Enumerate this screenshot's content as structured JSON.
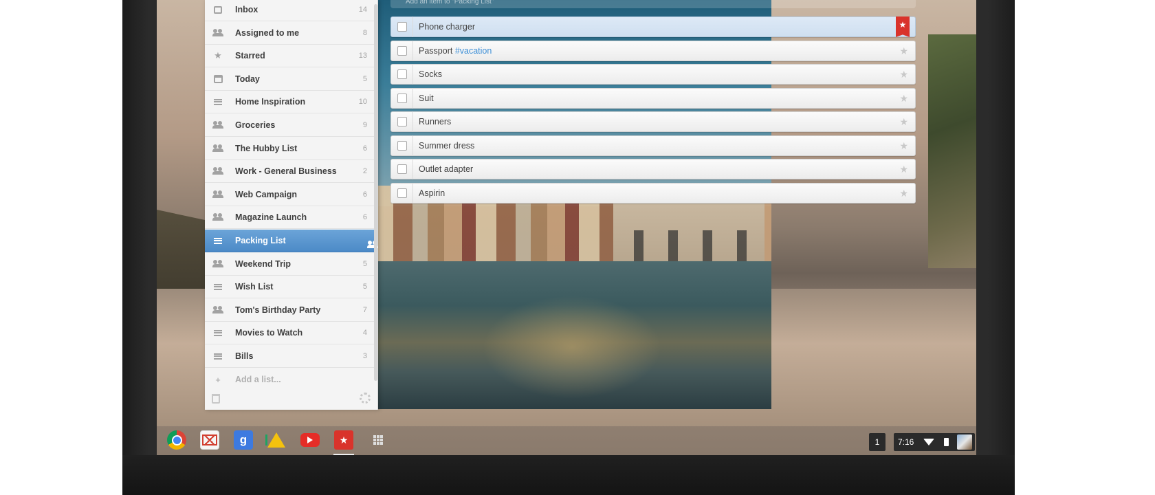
{
  "search": {
    "placeholder": "Add an item to \"Packing List\""
  },
  "sidebar": {
    "items": [
      {
        "label": "Inbox",
        "count": "14",
        "icon": "inbox-icon"
      },
      {
        "label": "Assigned to me",
        "count": "8",
        "icon": "assigned-icon"
      },
      {
        "label": "Starred",
        "count": "13",
        "icon": "star-icon"
      },
      {
        "label": "Today",
        "count": "5",
        "icon": "calendar-icon"
      },
      {
        "label": "Home Inspiration",
        "count": "10",
        "icon": "list-icon"
      },
      {
        "label": "Groceries",
        "count": "9",
        "icon": "shared-list-icon"
      },
      {
        "label": "The Hubby List",
        "count": "6",
        "icon": "shared-list-icon"
      },
      {
        "label": "Work - General Business",
        "count": "2",
        "icon": "shared-list-icon"
      },
      {
        "label": "Web Campaign",
        "count": "6",
        "icon": "shared-list-icon"
      },
      {
        "label": "Magazine Launch",
        "count": "6",
        "icon": "shared-list-icon"
      },
      {
        "label": "Packing List",
        "count": "",
        "icon": "list-icon",
        "active": true
      },
      {
        "label": "Weekend Trip",
        "count": "5",
        "icon": "shared-list-icon"
      },
      {
        "label": "Wish List",
        "count": "5",
        "icon": "list-icon"
      },
      {
        "label": "Tom's Birthday Party",
        "count": "7",
        "icon": "shared-list-icon"
      },
      {
        "label": "Movies to Watch",
        "count": "4",
        "icon": "list-icon"
      },
      {
        "label": "Bills",
        "count": "3",
        "icon": "list-icon"
      }
    ],
    "add_list": "Add a list..."
  },
  "tasks": [
    {
      "label": "Phone charger",
      "tag": "",
      "starred": true,
      "selected": true
    },
    {
      "label": "Passport ",
      "tag": "#vacation",
      "starred": false
    },
    {
      "label": "Socks",
      "tag": "",
      "starred": false
    },
    {
      "label": "Suit",
      "tag": "",
      "starred": false
    },
    {
      "label": "Runners",
      "tag": "",
      "starred": false
    },
    {
      "label": "Summer dress",
      "tag": "",
      "starred": false
    },
    {
      "label": "Outlet adapter",
      "tag": "",
      "starred": false
    },
    {
      "label": "Aspirin",
      "tag": "",
      "starred": false
    }
  ],
  "shelf": {
    "apps": [
      "chrome-icon",
      "gmail-icon",
      "google-search-icon",
      "drive-icon",
      "youtube-icon",
      "wunderlist-icon",
      "app-launcher-icon"
    ],
    "google_glyph": "g",
    "wunderlist_glyph": "★"
  },
  "tray": {
    "workspace": "1",
    "time": "7:16"
  },
  "colors": {
    "accent": "#4c8ac7",
    "star": "#d9332b",
    "tag": "#3b8ed6"
  }
}
